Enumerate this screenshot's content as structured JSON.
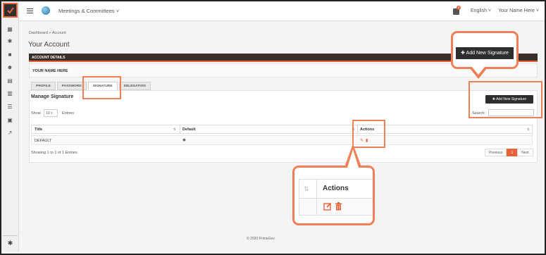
{
  "topbar": {
    "app_title": "Meetings & Committees ˅",
    "notification_count": "8",
    "language": "English ˅",
    "user_name": "Your Name Here ˅"
  },
  "breadcrumb": "Dashboard > Account",
  "page_title": "Your Account",
  "panel": {
    "header": "ACCOUNT DETAILS",
    "name": "YOUR NAME HERE"
  },
  "tabs": [
    {
      "label": "PROFILE"
    },
    {
      "label": "PASSWORD"
    },
    {
      "label": "SIGNATURE",
      "active": true
    },
    {
      "label": "DELEGATION"
    }
  ],
  "signature": {
    "section_title": "Manage Signature",
    "show_label": "Show",
    "page_size": "10",
    "entries_label": "Entries",
    "add_button": "✚ Add New Signature",
    "search_label": "Search:",
    "search_value": "",
    "columns": [
      "Title",
      "Default",
      "Actions"
    ],
    "rows": [
      {
        "title": "DEFAULT",
        "default": "◉"
      }
    ],
    "showing_text": "Showing 1 to 1 of 1 Entries",
    "pager": {
      "prev": "Previous",
      "current": "1",
      "next": "Next"
    }
  },
  "footer": "© 2020 PrimeGov",
  "callouts": {
    "add_button_zoom": "✚ Add New Signature",
    "actions_zoom": "Actions"
  },
  "colors": {
    "accent": "#e8623a",
    "callout": "#ef7f57",
    "header_dark": "#3a2e2b"
  }
}
